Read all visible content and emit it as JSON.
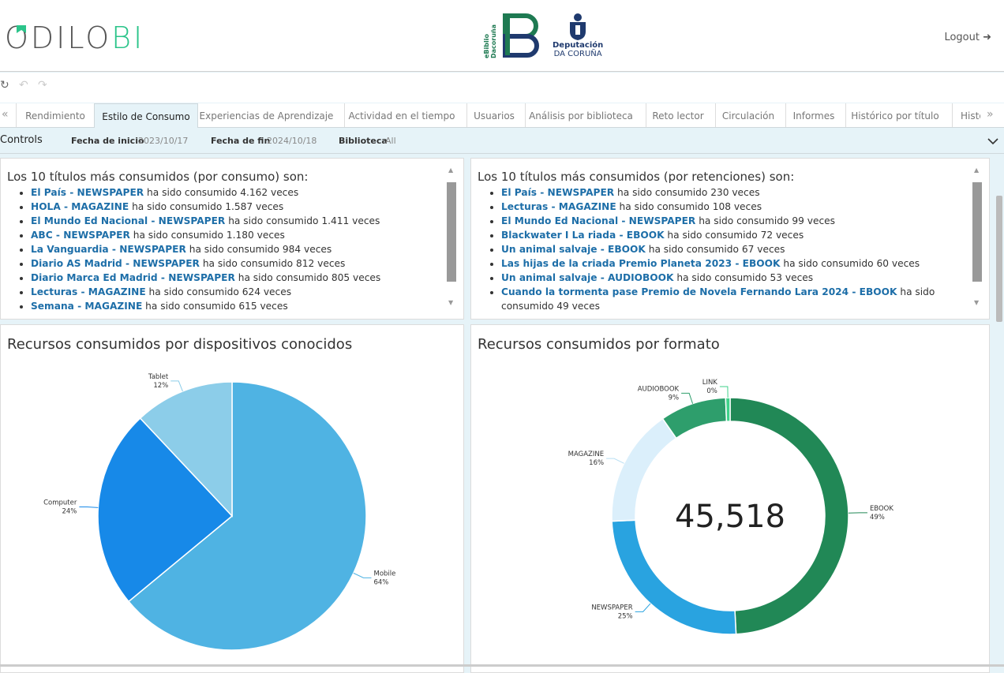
{
  "header": {
    "logo_main": "ODILO",
    "logo_accent": "BI",
    "ebiblio_line1": "eBiblio",
    "ebiblio_line2": "Dacoruña",
    "dep_line1": "Deputación",
    "dep_line2": "DA CORUÑA",
    "logout": "Logout"
  },
  "toolbar": {
    "refresh_icon": "↻",
    "undo_icon": "↶",
    "redo_icon": "↷"
  },
  "tabs": [
    {
      "label": "Rendimiento"
    },
    {
      "label": "Estilo de Consumo",
      "active": true
    },
    {
      "label": "Experiencias de Aprendizaje"
    },
    {
      "label": "Actividad en el tiempo"
    },
    {
      "label": "Usuarios"
    },
    {
      "label": "Análisis por biblioteca"
    },
    {
      "label": "Reto lector"
    },
    {
      "label": "Circulación"
    },
    {
      "label": "Informes"
    },
    {
      "label": "Histórico por título"
    },
    {
      "label": "Histó"
    }
  ],
  "controls": {
    "title": "Controls",
    "start_label": "Fecha de inicio",
    "start_value": "2023/10/17",
    "end_label": "Fecha de fin",
    "end_value": "2024/10/18",
    "library_label": "Biblioteca",
    "library_value": "All"
  },
  "top_consumo": {
    "title": "Los 10 títulos más consumidos (por consumo) son:",
    "items": [
      {
        "title": "El País - NEWSPAPER",
        "text": " ha sido consumido 4.162 veces"
      },
      {
        "title": "HOLA - MAGAZINE",
        "text": " ha sido consumido 1.587 veces"
      },
      {
        "title": "El Mundo Ed Nacional - NEWSPAPER",
        "text": " ha sido consumido 1.411 veces"
      },
      {
        "title": "ABC - NEWSPAPER",
        "text": " ha sido consumido 1.180 veces"
      },
      {
        "title": "La Vanguardia - NEWSPAPER",
        "text": " ha sido consumido 984 veces"
      },
      {
        "title": "Diario AS Madrid - NEWSPAPER",
        "text": " ha sido consumido 812 veces"
      },
      {
        "title": "Diario Marca Ed Madrid - NEWSPAPER",
        "text": " ha sido consumido 805 veces"
      },
      {
        "title": "Lecturas - MAGAZINE",
        "text": " ha sido consumido 624 veces"
      },
      {
        "title": "Semana - MAGAZINE",
        "text": " ha sido consumido 615 veces"
      }
    ]
  },
  "top_retenciones": {
    "title": "Los 10 títulos más consumidos (por retenciones) son:",
    "items": [
      {
        "title": "El País - NEWSPAPER",
        "text": " ha sido consumido 230 veces"
      },
      {
        "title": "Lecturas - MAGAZINE",
        "text": " ha sido consumido 108 veces"
      },
      {
        "title": "El Mundo Ed Nacional - NEWSPAPER",
        "text": " ha sido consumido 99 veces"
      },
      {
        "title": "Blackwater I La riada - EBOOK",
        "text": " ha sido consumido 72 veces"
      },
      {
        "title": "Un animal salvaje - EBOOK",
        "text": " ha sido consumido 67 veces"
      },
      {
        "title": "Las hijas de la criada Premio Planeta 2023 - EBOOK",
        "text": " ha sido consumido 60 veces"
      },
      {
        "title": "Un animal salvaje - AUDIOBOOK",
        "text": " ha sido consumido 53 veces"
      },
      {
        "title": "Cuando la tormenta pase Premio de Novela Fernando Lara 2024 - EBOOK",
        "text": " ha sido consumido 49 veces"
      }
    ]
  },
  "chart_data": [
    {
      "type": "pie",
      "title": "Recursos consumidos por dispositivos conocidos",
      "categories": [
        "Mobile",
        "Computer",
        "Tablet"
      ],
      "values": [
        64,
        24,
        12
      ],
      "labels": [
        "64%",
        "24%",
        "12%"
      ],
      "colors": [
        "#4fb3e3",
        "#1789e8",
        "#8ccde9"
      ]
    },
    {
      "type": "pie",
      "title": "Recursos consumidos por formato",
      "center_label": "45,518",
      "categories": [
        "EBOOK",
        "NEWSPAPER",
        "MAGAZINE",
        "AUDIOBOOK",
        "LINK"
      ],
      "values": [
        49,
        25,
        16,
        9,
        0.6
      ],
      "labels": [
        "49%",
        "25%",
        "16%",
        "9%",
        "0%"
      ],
      "colors": [
        "#218856",
        "#29a3e0",
        "#dbeffb",
        "#2e9e6c",
        "#3fd28a"
      ]
    }
  ]
}
